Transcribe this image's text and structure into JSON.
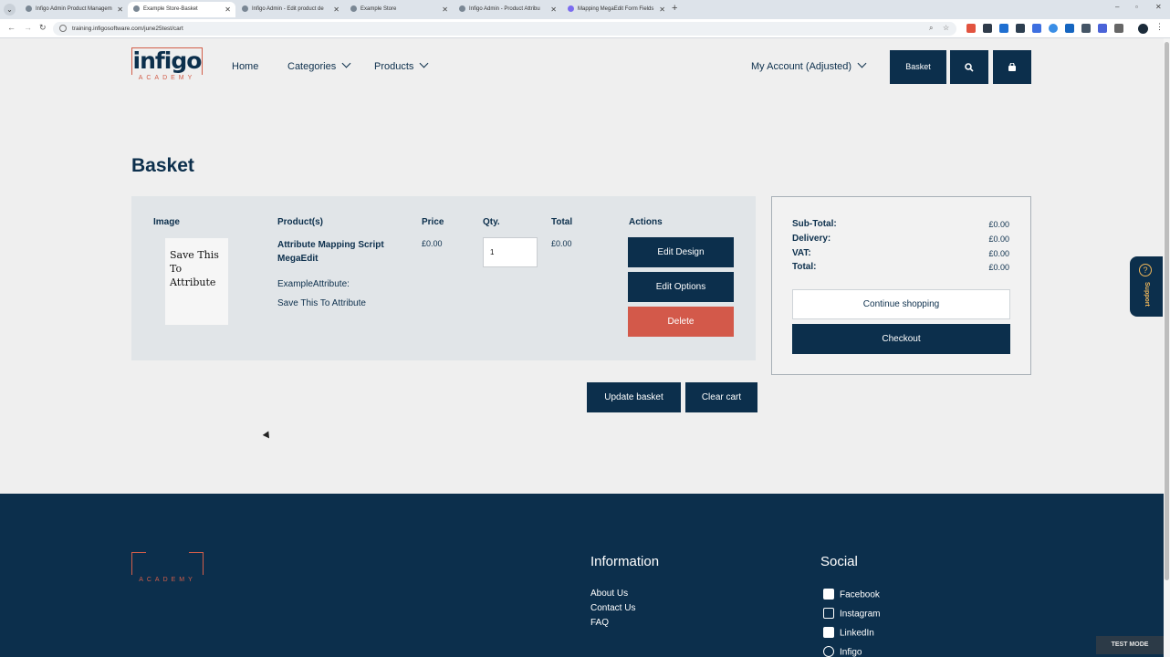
{
  "browser": {
    "tabs": [
      {
        "title": "Infigo Admin Product Managem",
        "active": false
      },
      {
        "title": "Example Store-Basket",
        "active": true
      },
      {
        "title": "Infigo Admin - Edit product de",
        "active": false
      },
      {
        "title": "Example Store",
        "active": false
      },
      {
        "title": "Infigo Admin - Product Attribu",
        "active": false
      },
      {
        "title": "Mapping MegaEdit Form Fields",
        "active": false
      }
    ],
    "url": "training.infigosoftware.com/june25test/cart"
  },
  "site": {
    "logo_word": "infigo",
    "logo_sub": "ACADEMY",
    "nav": {
      "home": "Home",
      "categories": "Categories",
      "products": "Products",
      "account": "My Account (Adjusted)",
      "basket_button": "Basket"
    }
  },
  "cart": {
    "title": "Basket",
    "headers": {
      "image": "Image",
      "products": "Product(s)",
      "price": "Price",
      "qty": "Qty.",
      "total": "Total",
      "actions": "Actions"
    },
    "item": {
      "thumb_text": "Save This To Attribute",
      "name": "Attribute Mapping Script MegaEdit",
      "attribute_label": "ExampleAttribute:",
      "attribute_value": "Save This To Attribute",
      "price": "£0.00",
      "qty": "1",
      "total": "£0.00",
      "edit_design": "Edit Design",
      "edit_options": "Edit Options",
      "delete": "Delete"
    },
    "update_basket": "Update basket",
    "clear_cart": "Clear cart"
  },
  "summary": {
    "subtotal_label": "Sub-Total:",
    "subtotal": "£0.00",
    "delivery_label": "Delivery:",
    "delivery": "£0.00",
    "vat_label": "VAT:",
    "vat": "£0.00",
    "total_label": "Total:",
    "total": "£0.00",
    "continue": "Continue shopping",
    "checkout": "Checkout"
  },
  "support": {
    "label": "Support",
    "icon": "?"
  },
  "footer": {
    "logo_sub": "ACADEMY",
    "info_heading": "Information",
    "info_links": [
      "About Us",
      "Contact Us",
      "FAQ"
    ],
    "social_heading": "Social",
    "social_links": [
      "Facebook",
      "Instagram",
      "LinkedIn",
      "Infigo"
    ],
    "test_mode": "TEST MODE"
  },
  "colors": {
    "navy": "#0c2f4c",
    "accent": "#d25e4a",
    "delete": "#d3594a",
    "support_accent": "#f0b75a"
  }
}
